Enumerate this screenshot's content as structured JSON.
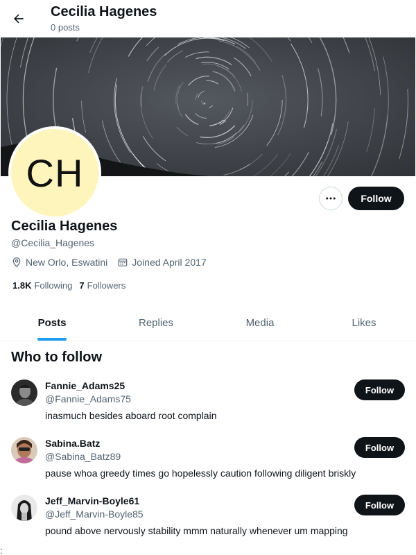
{
  "header": {
    "back_icon": "arrow-left-icon",
    "title": "Cecilia Hagenes",
    "subtitle": "0 posts"
  },
  "profile": {
    "avatar_initials": "CH",
    "avatar_bg": "#fdf5bb",
    "name": "Cecilia Hagenes",
    "handle": "@Cecilia_Hagenes",
    "location": "New Orlo, Eswatini",
    "location_icon": "location-pin-icon",
    "joined": "Joined April 2017",
    "joined_icon": "calendar-icon",
    "following_count": "1.8K",
    "following_label": "Following",
    "followers_count": "7",
    "followers_label": "Followers",
    "more_icon": "more-horizontal-icon",
    "follow_label": "Follow"
  },
  "tabs": [
    {
      "label": "Posts",
      "active": true
    },
    {
      "label": "Replies",
      "active": false
    },
    {
      "label": "Media",
      "active": false
    },
    {
      "label": "Likes",
      "active": false
    }
  ],
  "who_to_follow": {
    "title": "Who to follow",
    "suggestions": [
      {
        "name": "Fannie_Adams25",
        "handle": "@Fannie_Adams75",
        "bio": "inasmuch besides aboard root complain",
        "follow_label": "Follow"
      },
      {
        "name": "Sabina.Batz",
        "handle": "@Sabina_Batz89",
        "bio": "pause whoa greedy times go hopelessly caution following diligent briskly",
        "follow_label": "Follow"
      },
      {
        "name": "Jeff_Marvin-Boyle61",
        "handle": "@Jeff_Marvin-Boyle85",
        "bio": "pound above nervously stability mmm naturally whenever um mapping",
        "follow_label": "Follow"
      }
    ]
  },
  "colors": {
    "accent": "#1d9bf0",
    "button_dark": "#0f1419",
    "secondary_text": "#536471"
  },
  "corner_mark": ":"
}
